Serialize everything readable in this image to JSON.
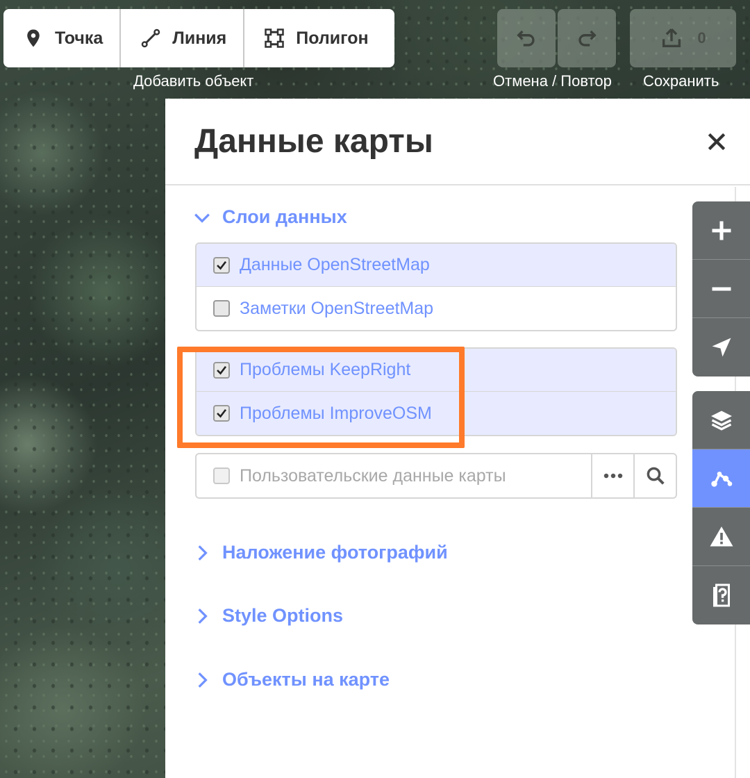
{
  "toolbar": {
    "add": {
      "point_label": "Точка",
      "line_label": "Линия",
      "area_label": "Полигон",
      "group_label": "Добавить объект"
    },
    "history_label": "Отмена / Повтор",
    "save_count": "0",
    "save_label": "Сохранить"
  },
  "panel": {
    "title": "Данные карты",
    "sections": {
      "data_layers": "Слои данных",
      "photo_overlays": "Наложение фотографий",
      "style_options": "Style Options",
      "map_features": "Объекты на карте"
    },
    "layers_group1": [
      {
        "label": "Данные OpenStreetMap",
        "checked": true
      },
      {
        "label": "Заметки OpenStreetMap",
        "checked": false
      }
    ],
    "layers_group2": [
      {
        "label": "Проблемы KeepRight",
        "checked": true
      },
      {
        "label": "Проблемы ImproveOSM",
        "checked": true
      }
    ],
    "custom_data": {
      "label": "Пользовательские данные карты",
      "checked": false
    }
  },
  "colors": {
    "accent": "#7092ff",
    "highlight": "#ff7a2b",
    "active_row": "#e8ebff"
  },
  "map_controls": [
    "zoom-in",
    "zoom-out",
    "geolocate",
    "background",
    "map-data",
    "issues",
    "help"
  ]
}
